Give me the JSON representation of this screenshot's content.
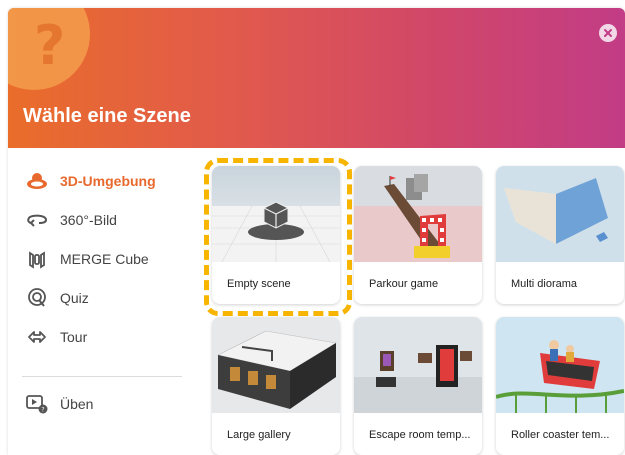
{
  "header": {
    "title": "Wähle eine Szene"
  },
  "sidebar": {
    "items": [
      {
        "label": "3D-Umgebung",
        "icon": "3d-environment-icon",
        "active": true
      },
      {
        "label": "360°-Bild",
        "icon": "360-image-icon"
      },
      {
        "label": "MERGE Cube",
        "icon": "merge-cube-icon"
      },
      {
        "label": "Quiz",
        "icon": "quiz-icon"
      },
      {
        "label": "Tour",
        "icon": "tour-icon"
      },
      {
        "label": "Üben",
        "icon": "practice-icon"
      }
    ]
  },
  "scenes": [
    {
      "label": "Empty scene",
      "selected": true
    },
    {
      "label": "Parkour game"
    },
    {
      "label": "Multi diorama"
    },
    {
      "label": "Large gallery"
    },
    {
      "label": "Escape room temp..."
    },
    {
      "label": "Roller coaster tem..."
    }
  ],
  "colors": {
    "accent": "#e8692d",
    "selection": "#f7b500",
    "header_start": "#ea6d2a",
    "header_end": "#c23c86"
  }
}
